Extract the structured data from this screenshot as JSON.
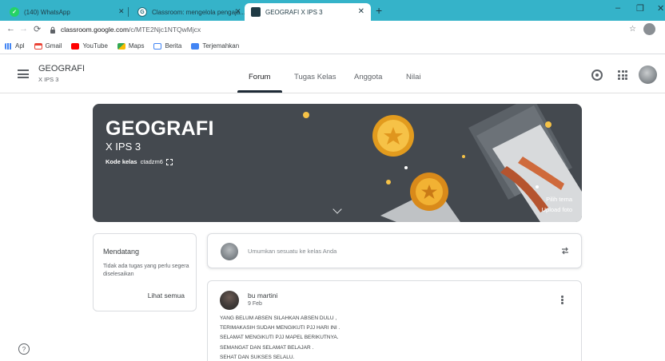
{
  "browser": {
    "tabs": [
      {
        "title": "(140) WhatsApp"
      },
      {
        "title": "Classroom: mengelola pengaja..."
      },
      {
        "title": "GEOGRAFI X IPS 3"
      }
    ],
    "url_host": "classroom.google.com",
    "url_path": "/c/MTE2Njc1NTQwMjcx",
    "bookmarks": [
      {
        "label": "Apl"
      },
      {
        "label": "Gmail"
      },
      {
        "label": "YouTube"
      },
      {
        "label": "Maps"
      },
      {
        "label": "Berita"
      },
      {
        "label": "Terjemahkan"
      }
    ]
  },
  "header": {
    "class_name": "GEOGRAFI",
    "section": "X IPS 3",
    "tabs": [
      {
        "label": "Forum"
      },
      {
        "label": "Tugas Kelas"
      },
      {
        "label": "Anggota"
      },
      {
        "label": "Nilai"
      }
    ]
  },
  "banner": {
    "title": "GEOGRAFI",
    "subtitle": "X IPS 3",
    "code_label": "Kode kelas",
    "code_value": "ctadzm6",
    "select_theme": "Pilih tema",
    "upload_photo": "Upload foto"
  },
  "upcoming": {
    "title": "Mendatang",
    "empty_text": "Tidak ada tugas yang perlu segera diselesaikan",
    "see_all": "Lihat semua"
  },
  "announce": {
    "placeholder": "Umumkan sesuatu ke kelas Anda"
  },
  "post": {
    "author": "bu martini",
    "date": "9 Feb",
    "lines": [
      "YANG BELUM ABSEN SILAHKAN ABSEN DULU ,",
      "TERIMAKASIH SUDAH MENGIKUTI PJJ HARI INI .",
      "SELAMAT MENGIKUTI PJJ MAPEL BERIKUTNYA.",
      "SEMANGAT DAN SELAMAT BELAJAR .",
      "SEHAT DAN SUKSES SELALU."
    ]
  },
  "colors": {
    "tabstrip": "#35b3c9",
    "banner": "#44494f",
    "tab_indicator": "#1e2a36",
    "gold": "#f2b233"
  }
}
